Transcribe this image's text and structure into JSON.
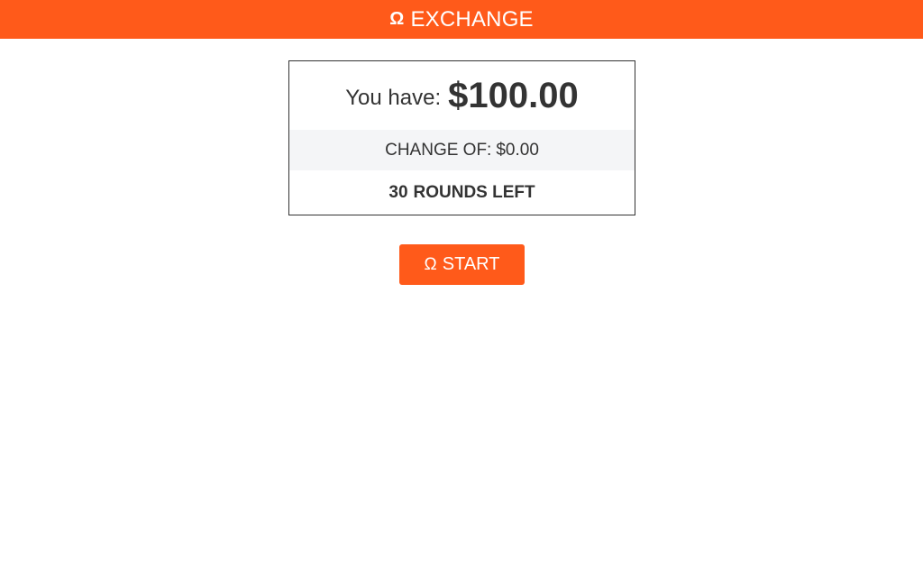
{
  "header": {
    "icon": "omega-icon",
    "icon_glyph": "Ω",
    "title": "EXCHANGE"
  },
  "balance": {
    "label": "You have:",
    "value": "$100.00"
  },
  "change": {
    "label": "CHANGE OF:",
    "value": "$0.00"
  },
  "rounds": {
    "count": "30",
    "label": "ROUNDS LEFT"
  },
  "start_button": {
    "icon": "omega-icon",
    "icon_glyph": "Ω",
    "label": "START"
  },
  "colors": {
    "accent": "#ff5a1a",
    "text": "#333333",
    "row_background": "#f4f5f7"
  }
}
